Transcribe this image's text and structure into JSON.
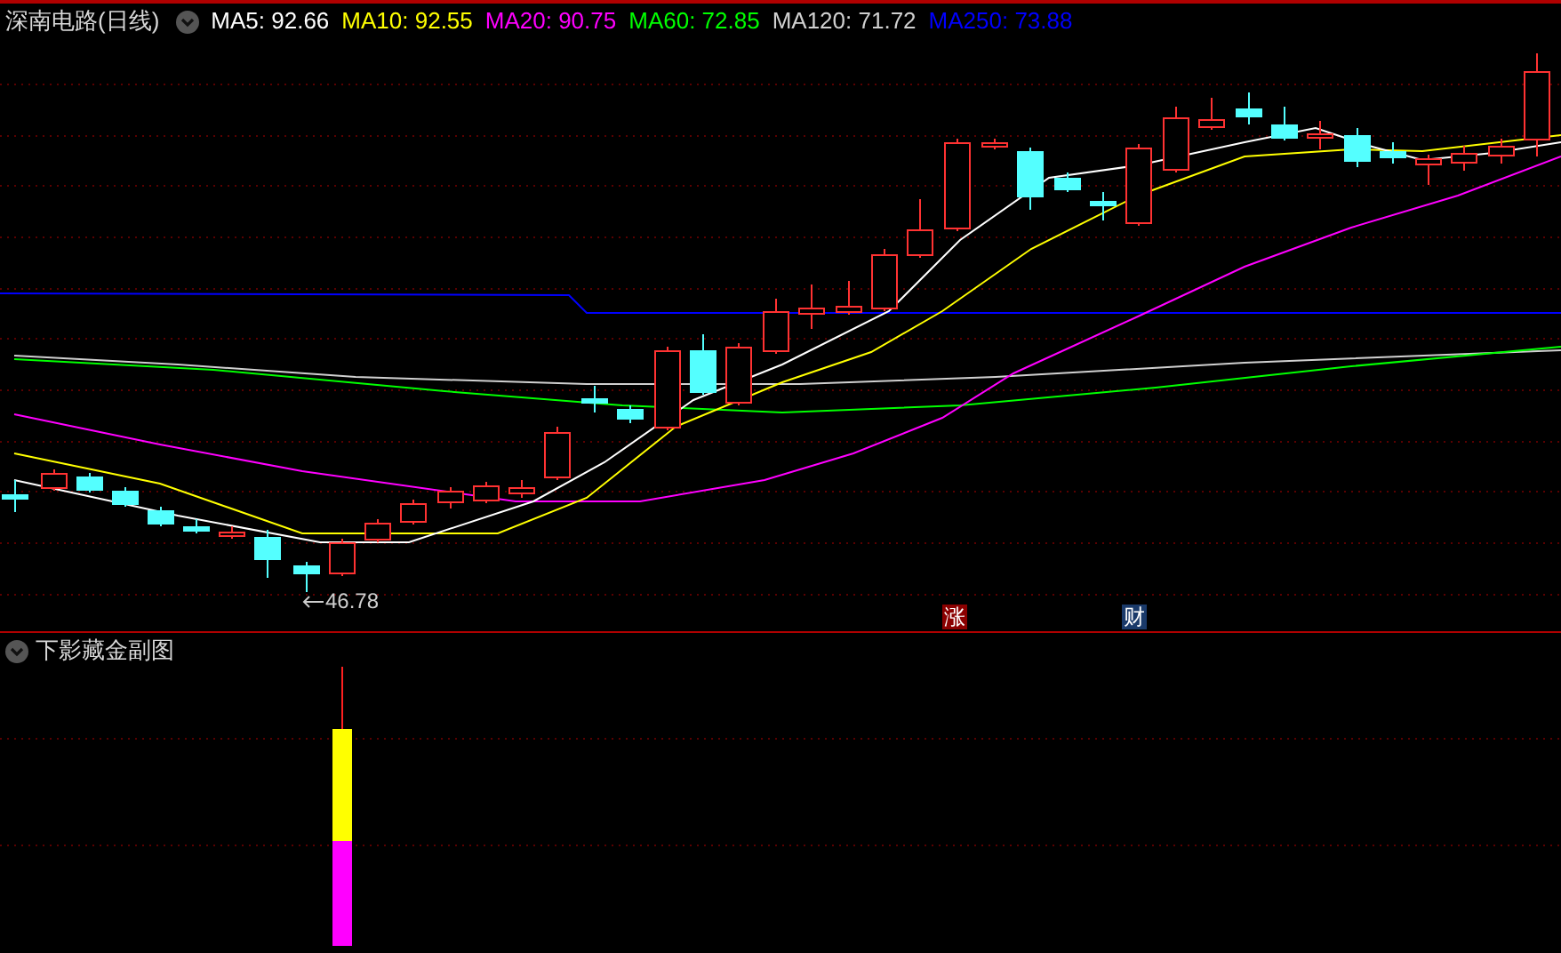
{
  "main_chart": {
    "title": "深南电路(日线)",
    "legend": [
      {
        "text": "MA5: 92.66",
        "color": "#ffffff"
      },
      {
        "text": "MA10: 92.55",
        "color": "#ffff00"
      },
      {
        "text": "MA20: 90.75",
        "color": "#ff00ff"
      },
      {
        "text": "MA60: 72.85",
        "color": "#00ff00"
      },
      {
        "text": "MA120: 71.72",
        "color": "#d0d0d0"
      },
      {
        "text": "MA250: 73.88",
        "color": "#0000ff"
      }
    ],
    "low_marker": "46.78",
    "events": [
      {
        "kind": "limit_up",
        "text": "涨"
      },
      {
        "kind": "finance",
        "text": "财"
      }
    ]
  },
  "indicator": {
    "title": "下影藏金副图"
  }
}
